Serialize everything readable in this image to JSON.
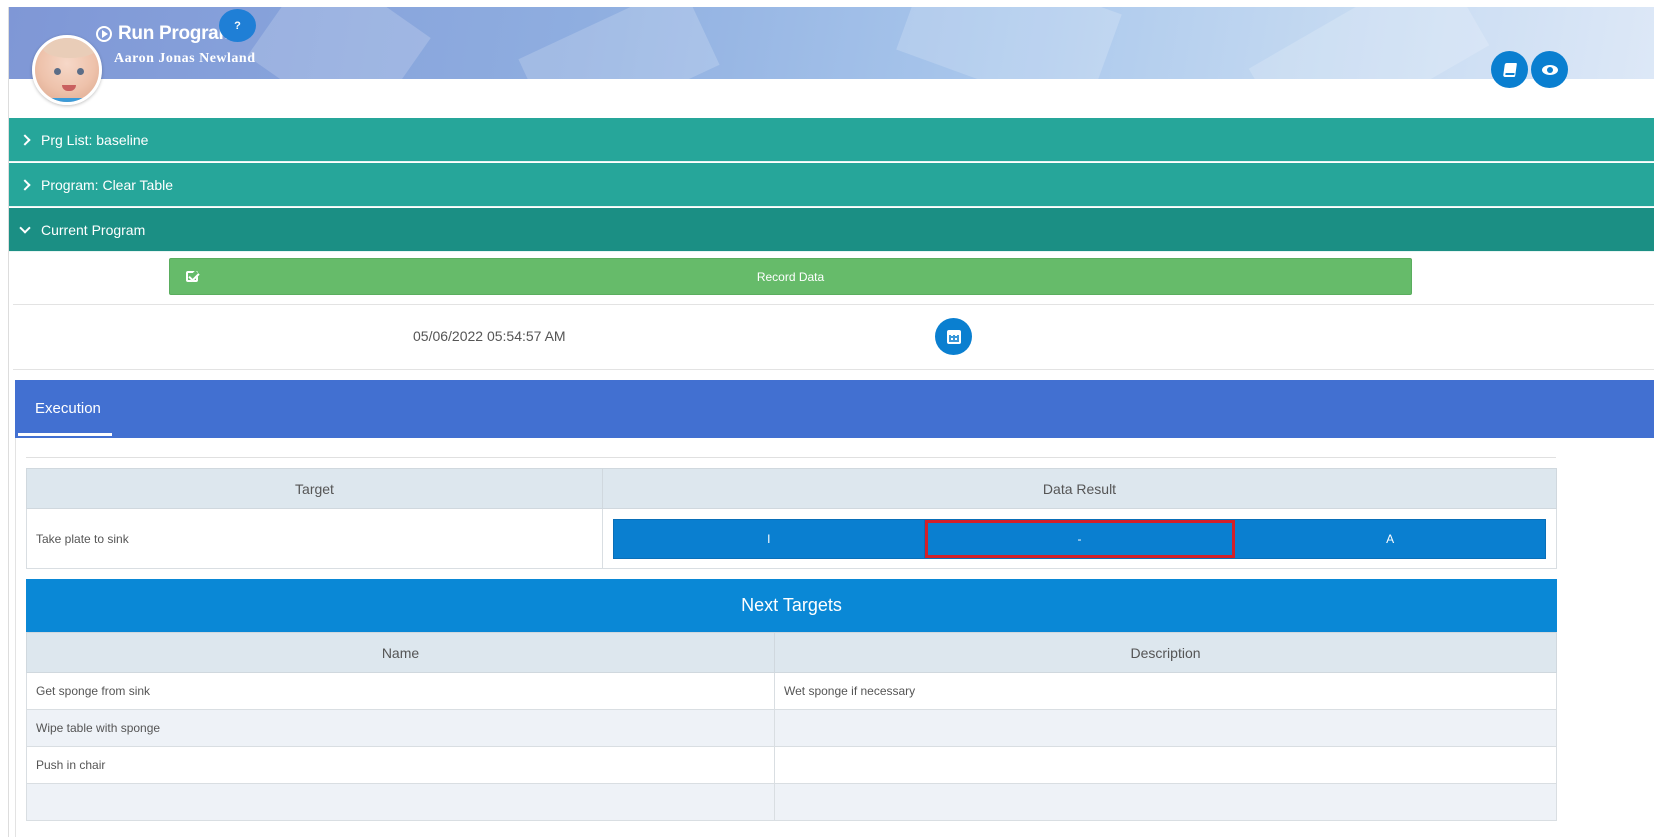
{
  "header": {
    "title": "Run Program",
    "help_label": "?",
    "patient_name": "Aaron Jonas Newland"
  },
  "accordion": [
    {
      "label": "Prg List: baseline",
      "expanded": false
    },
    {
      "label": "Program: Clear Table",
      "expanded": false
    },
    {
      "label": "Current Program",
      "expanded": true
    }
  ],
  "record": {
    "label": "Record Data"
  },
  "session": {
    "datetime": "05/06/2022 05:54:57 AM"
  },
  "tabs": [
    {
      "label": "Execution",
      "active": true
    }
  ],
  "target_table": {
    "headers": [
      "Target",
      "Data Result"
    ],
    "row": {
      "target": "Take plate to sink",
      "options": [
        "I",
        "-",
        "A"
      ],
      "highlighted_option": "-"
    }
  },
  "next_targets": {
    "title": "Next Targets",
    "headers": [
      "Name",
      "Description"
    ],
    "rows": [
      {
        "name": "Get sponge from sink",
        "description": "Wet sponge if necessary"
      },
      {
        "name": "Wipe table with sponge",
        "description": ""
      },
      {
        "name": "Push in chair",
        "description": ""
      }
    ]
  },
  "colors": {
    "accordion": "#26a69a",
    "record_button": "#66bb6a",
    "tab_bar": "#4270d1",
    "primary_button": "#0a7fd0",
    "highlight_border": "#d32029"
  }
}
